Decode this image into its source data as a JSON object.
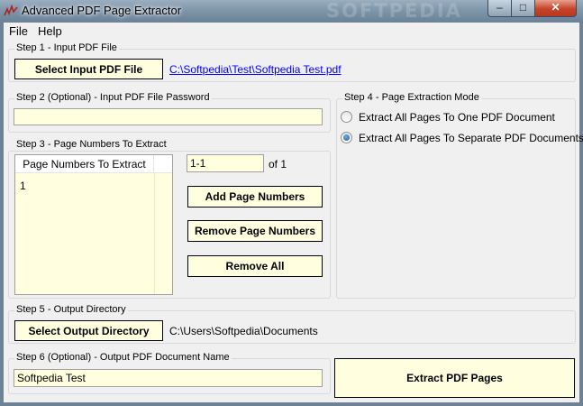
{
  "window": {
    "title": "Advanced PDF Page Extractor",
    "watermark": "SOFTPEDIA",
    "minimize_glyph": "–",
    "maximize_glyph": "□",
    "close_glyph": "✕"
  },
  "menu": {
    "file": "File",
    "help": "Help"
  },
  "step1": {
    "label": "Step 1 - Input PDF File",
    "button": "Select Input PDF File",
    "path": "C:\\Softpedia\\Test\\Softpedia Test.pdf"
  },
  "step2": {
    "label": "Step 2 (Optional) - Input PDF File Password",
    "value": ""
  },
  "step3": {
    "label": "Step 3 - Page Numbers To Extract",
    "column_header": "Page Numbers To Extract",
    "rows": [
      "1"
    ],
    "range_value": "1-1",
    "of_text": "of 1",
    "add_button": "Add Page Numbers",
    "remove_button": "Remove Page Numbers",
    "remove_all_button": "Remove All"
  },
  "step4": {
    "label": "Step 4 - Page Extraction Mode",
    "option_one": "Extract All Pages To One PDF Document",
    "option_separate": "Extract All Pages To Separate PDF Documents",
    "selected": "separate"
  },
  "step5": {
    "label": "Step 5 - Output Directory",
    "button": "Select Output Directory",
    "path": "C:\\Users\\Softpedia\\Documents"
  },
  "step6": {
    "label": "Step 6 (Optional) - Output PDF Document Name",
    "value": "Softpedia Test"
  },
  "extract_button": "Extract PDF Pages",
  "colors": {
    "field_bg": "#ffffe0",
    "link": "#0000ff",
    "radio_accent": "#1f5fa8"
  }
}
